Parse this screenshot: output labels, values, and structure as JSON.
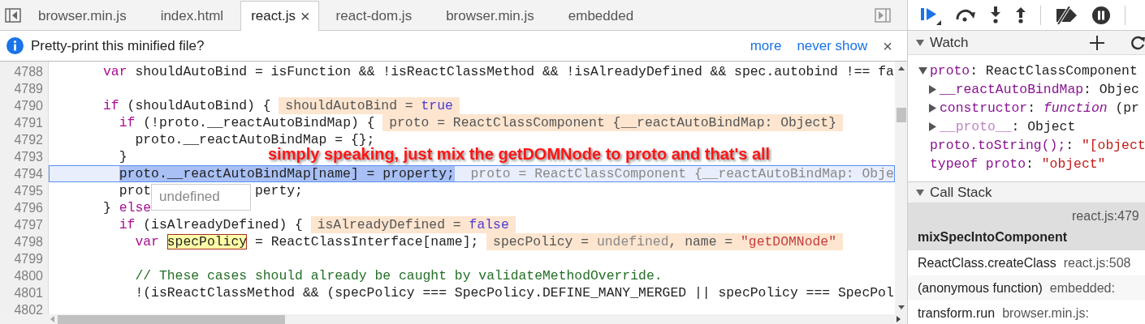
{
  "editor_tabs": [
    {
      "label": "browser.min.js",
      "selected": false
    },
    {
      "label": "index.html",
      "selected": false
    },
    {
      "label": "react.js",
      "selected": true,
      "close": "×"
    },
    {
      "label": "react-dom.js",
      "selected": false
    },
    {
      "label": "browser.min.js",
      "selected": false
    },
    {
      "label": "embedded",
      "selected": false
    }
  ],
  "infobar": {
    "message": "Pretty-print this minified file?",
    "links": [
      "more",
      "never show"
    ],
    "close": "×"
  },
  "code": {
    "note": "simply speaking, just mix the getDOMNode to proto and that's all",
    "lines": [
      {
        "number": "4788",
        "current": false,
        "code": [
          {
            "kind": "keyword",
            "text": "      var"
          },
          {
            "kind": "plain",
            "text": " shouldAutoBind = isFunction && !isReactClassMethod && !isAlreadyDefined && spec.autobind !== fa"
          }
        ]
      },
      {
        "number": "4789",
        "current": false
      },
      {
        "number": "4790",
        "current": false,
        "code": [
          {
            "kind": "keyword",
            "text": "      if"
          },
          {
            "kind": "plain",
            "text": " (shouldAutoBind) {"
          }
        ],
        "values": [
          {
            "kind": "plain",
            "text": "shouldAutoBind = "
          },
          {
            "kind": "bool",
            "text": "true"
          }
        ]
      },
      {
        "number": "4791",
        "current": false,
        "code": [
          {
            "kind": "keyword",
            "text": "        if"
          },
          {
            "kind": "plain",
            "text": " (!proto.__reactAutoBindMap) {"
          }
        ],
        "values": [
          {
            "kind": "plain",
            "text": "proto = ReactClassComponent {__reactAutoBindMap: Object}"
          }
        ]
      },
      {
        "number": "4792",
        "current": false,
        "code": [
          {
            "kind": "plain",
            "text": "          proto.__reactAutoBindMap = {};"
          }
        ]
      },
      {
        "number": "4793",
        "current": false,
        "code": [
          {
            "kind": "plain",
            "text": "        }"
          }
        ]
      },
      {
        "number": "4794",
        "current": true,
        "code": [
          {
            "kind": "selection",
            "text": "        proto.__reactAutoBindMap[name] = property;"
          }
        ],
        "values": [
          {
            "kind": "plain",
            "text": "proto = ReactClassComponent {__reactAutoBindMap: Obje"
          }
        ]
      },
      {
        "number": "4795",
        "current": false,
        "code": [
          {
            "kind": "plain",
            "text": "        prot"
          }
        ],
        "tooltip": "undefined",
        "code_after": [
          {
            "kind": "plain",
            "text": "perty;"
          }
        ]
      },
      {
        "number": "4796",
        "current": false,
        "code": [
          {
            "kind": "plain",
            "text": "      } "
          },
          {
            "kind": "keyword",
            "text": "else"
          }
        ]
      },
      {
        "number": "4797",
        "current": false,
        "code": [
          {
            "kind": "keyword",
            "text": "        if"
          },
          {
            "kind": "plain",
            "text": " (isAlreadyDefined) {"
          }
        ],
        "values": [
          {
            "kind": "plain",
            "text": "isAlreadyDefined = "
          },
          {
            "kind": "bool",
            "text": "false"
          }
        ]
      },
      {
        "number": "4798",
        "current": false,
        "code": [
          {
            "kind": "keyword",
            "text": "          var "
          },
          {
            "kind": "hover",
            "text": "specPolicy"
          },
          {
            "kind": "plain",
            "text": " = ReactClassInterface[name];"
          }
        ],
        "values": [
          {
            "kind": "plain",
            "text": "specPolicy = "
          },
          {
            "kind": "undefined",
            "text": "undefined"
          },
          {
            "kind": "plain",
            "text": ", name = "
          },
          {
            "kind": "string",
            "text": "\"getDOMNode\""
          }
        ]
      },
      {
        "number": "4799",
        "current": false
      },
      {
        "number": "4800",
        "current": false,
        "code": [
          {
            "kind": "comment",
            "text": "          // These cases should already be caught by validateMethodOverride."
          }
        ]
      },
      {
        "number": "4801",
        "current": false,
        "code": [
          {
            "kind": "plain",
            "text": "          !(isReactClassMethod && (specPolicy === SpecPolicy.DEFINE_MANY_MERGED || specPolicy === SpecPol"
          }
        ]
      },
      {
        "number": "4802",
        "current": false
      }
    ]
  },
  "sidebar": {
    "sections": [
      {
        "kind": "watch",
        "title": "Watch",
        "expanded": true,
        "items": [
          {
            "key": "proto",
            "value": [
              {
                "kind": "plain",
                "text": ": ReactClassComponent"
              }
            ],
            "expanded": true,
            "children": [
              {
                "key": "__reactAutoBindMap",
                "value": [
                  {
                    "kind": "plain",
                    "text": ": Objec"
                  }
                ],
                "expanded": false,
                "dimmed": false
              },
              {
                "key": "constructor",
                "value": [
                  {
                    "kind": "plain",
                    "text": ": "
                  },
                  {
                    "kind": "function",
                    "text": "function"
                  },
                  {
                    "kind": "plain",
                    "text": " (pr"
                  }
                ],
                "expanded": false,
                "dimmed": false
              },
              {
                "key": "__proto__",
                "value": [
                  {
                    "kind": "plain",
                    "text": ": Object"
                  }
                ],
                "expanded": false,
                "dimmed": true
              }
            ]
          },
          {
            "key": "proto.toString();",
            "value": [
              {
                "kind": "plain",
                "text": ": "
              },
              {
                "kind": "string",
                "text": "\"[object"
              }
            ]
          },
          {
            "key": "typeof proto",
            "value": [
              {
                "kind": "plain",
                "text": ": "
              },
              {
                "kind": "string",
                "text": "\"object\""
              }
            ]
          }
        ]
      },
      {
        "kind": "callstack",
        "title": "Call Stack",
        "expanded": true,
        "frames": [
          {
            "name": "mixSpecIntoComponent",
            "location": "react.js:479",
            "selected": true
          },
          {
            "name": "ReactClass.createClass",
            "location": "react.js:508",
            "selected": false
          },
          {
            "name": "(anonymous function)",
            "location": "embedded:",
            "selected": false
          },
          {
            "name": "transform.run",
            "location": "browser.min.js:",
            "selected": false
          }
        ]
      }
    ]
  }
}
